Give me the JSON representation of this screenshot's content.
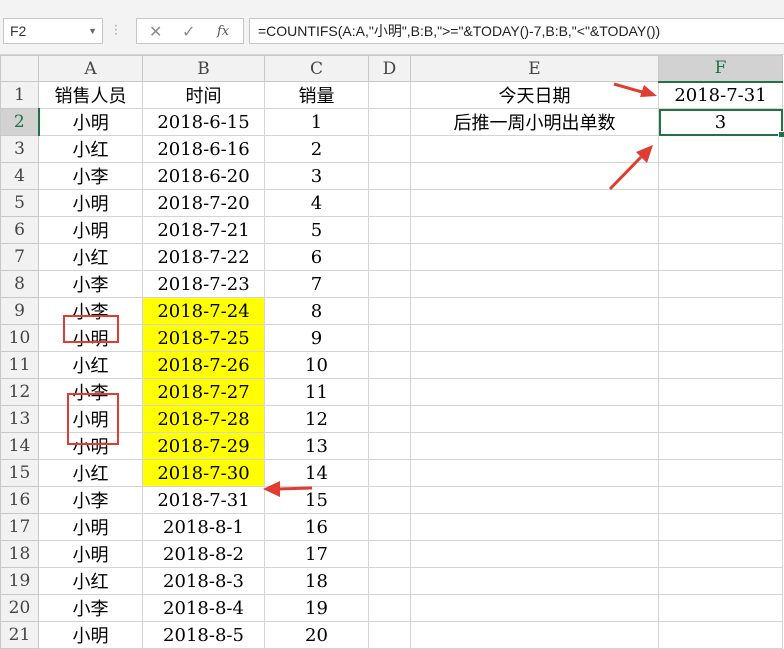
{
  "formula_bar": {
    "name_box": "F2",
    "cancel_glyph": "✕",
    "enter_glyph": "✓",
    "fx_label": "fx",
    "formula": "=COUNTIFS(A:A,\"小明\",B:B,\">=\"&TODAY()-7,B:B,\"<\"&TODAY())"
  },
  "columns": [
    "A",
    "B",
    "C",
    "D",
    "E",
    "F"
  ],
  "selected_cell": "F2",
  "rows": [
    {
      "num": "1",
      "a": "销售人员",
      "b": "时间",
      "c": "销量",
      "e": "今天日期",
      "f": "2018-7-31"
    },
    {
      "num": "2",
      "a": "小明",
      "b": "2018-6-15",
      "c": "1",
      "e": "后推一周小明出单数",
      "f": "3"
    },
    {
      "num": "3",
      "a": "小红",
      "b": "2018-6-16",
      "c": "2"
    },
    {
      "num": "4",
      "a": "小李",
      "b": "2018-6-20",
      "c": "3"
    },
    {
      "num": "5",
      "a": "小明",
      "b": "2018-7-20",
      "c": "4"
    },
    {
      "num": "6",
      "a": "小明",
      "b": "2018-7-21",
      "c": "5"
    },
    {
      "num": "7",
      "a": "小红",
      "b": "2018-7-22",
      "c": "6"
    },
    {
      "num": "8",
      "a": "小李",
      "b": "2018-7-23",
      "c": "7"
    },
    {
      "num": "9",
      "a": "小李",
      "b": "2018-7-24",
      "c": "8",
      "highlight": true
    },
    {
      "num": "10",
      "a": "小明",
      "b": "2018-7-25",
      "c": "9",
      "highlight": true
    },
    {
      "num": "11",
      "a": "小红",
      "b": "2018-7-26",
      "c": "10",
      "highlight": true
    },
    {
      "num": "12",
      "a": "小李",
      "b": "2018-7-27",
      "c": "11",
      "highlight": true
    },
    {
      "num": "13",
      "a": "小明",
      "b": "2018-7-28",
      "c": "12",
      "highlight": true
    },
    {
      "num": "14",
      "a": "小明",
      "b": "2018-7-29",
      "c": "13",
      "highlight": true
    },
    {
      "num": "15",
      "a": "小红",
      "b": "2018-7-30",
      "c": "14",
      "highlight": true
    },
    {
      "num": "16",
      "a": "小李",
      "b": "2018-7-31",
      "c": "15"
    },
    {
      "num": "17",
      "a": "小明",
      "b": "2018-8-1",
      "c": "16"
    },
    {
      "num": "18",
      "a": "小明",
      "b": "2018-8-2",
      "c": "17"
    },
    {
      "num": "19",
      "a": "小红",
      "b": "2018-8-3",
      "c": "18"
    },
    {
      "num": "20",
      "a": "小李",
      "b": "2018-8-4",
      "c": "19"
    },
    {
      "num": "21",
      "a": "小明",
      "b": "2018-8-5",
      "c": "20"
    }
  ],
  "colors": {
    "highlight": "#ffff00",
    "annotation": "#e03c31",
    "selection": "#217346"
  }
}
